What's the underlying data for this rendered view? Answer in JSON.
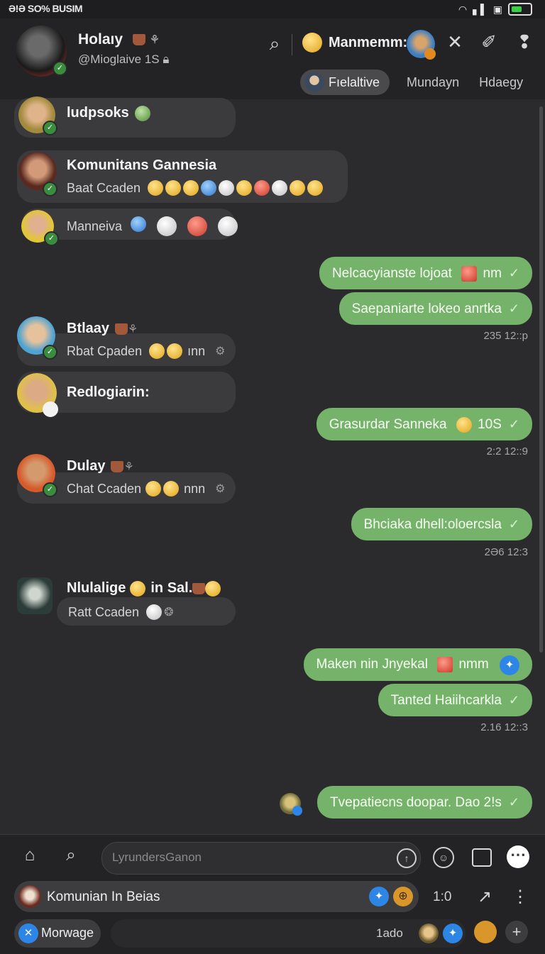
{
  "status": {
    "left": "Ə!Ə SO% BUSIM"
  },
  "header": {
    "name": "Holaıy",
    "handle": "@Mioglaive",
    "handle_num": "1S",
    "contact_label": "Manmemm:",
    "tabs": [
      "Fıelaltive",
      "Mundayn",
      "Hdaegy"
    ]
  },
  "messages": {
    "l1": {
      "name": "ludpsoks"
    },
    "l2": {
      "name": "Komunitans Gannesia",
      "text": "Baat Ccaden"
    },
    "l3": {
      "name": "Manneiva"
    },
    "r1": {
      "text": "Nelcacyianste lojoat",
      "suffix": "nm"
    },
    "r2": {
      "text": "Saepaniarte lokeo anrtka"
    },
    "t1": "235 12::p",
    "l4": {
      "name": "Btlaay",
      "text": "Rbat Cpaden",
      "suffix": "ınn"
    },
    "l5": {
      "name": "Redlogiarin:"
    },
    "r3": {
      "text": "Grasurdar Sanneka",
      "suffix": "10S"
    },
    "t2": "2:2 12::9",
    "l6": {
      "name": "Dulay",
      "text": "Chat Ccaden",
      "suffix": "nnn"
    },
    "r4": {
      "text": "Bhciaka dhell:oloercsla"
    },
    "t3": "2Ə6 12:3",
    "l7": {
      "name": "Nlulalige",
      "name2": "in Sal.",
      "text": "Ratt Ccaden"
    },
    "r5": {
      "text": "Maken nin Jnyekal",
      "suffix": "nmm"
    },
    "r6": {
      "text": "Tanted Haiihcarkla"
    },
    "t4": "2.16 12::3",
    "r7": {
      "text": "Tvepatiecns doopar. Dao 2!s"
    }
  },
  "composer": {
    "placeholder": "LyrundersGanon",
    "chat_name": "Komunian In Beias",
    "ratio": "1:0",
    "morwage": "Morwage",
    "field_value": "1ado"
  },
  "colors": {
    "bg": "#2b2b2d",
    "outgoing": "#76b36a",
    "incoming": "#3b3b3e",
    "accent": "#2d86e6"
  }
}
